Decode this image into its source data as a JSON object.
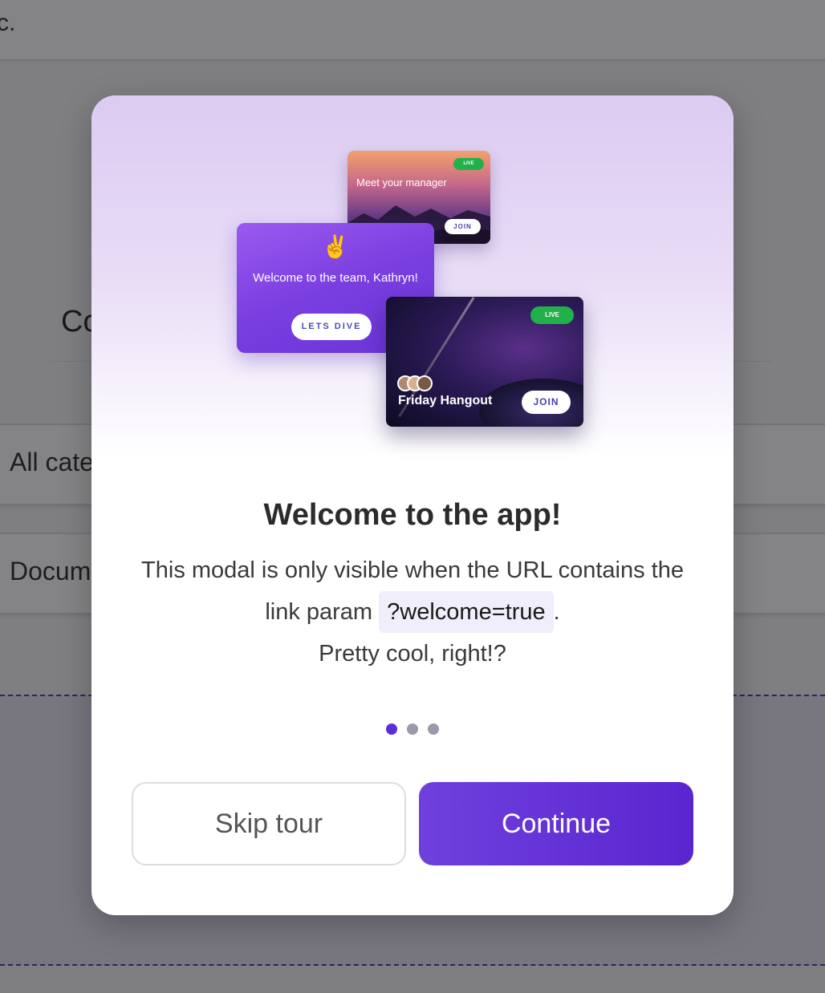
{
  "background": {
    "topbar_fragment": "c.",
    "heading_fragment": "Co",
    "select_1_fragment": "All cate",
    "select_2_fragment": "Docum"
  },
  "hero": {
    "manager_card": {
      "badge": "LIVE",
      "title": "Meet your manager",
      "join_label": "JOIN"
    },
    "welcome_card": {
      "emoji": "✌️",
      "text": "Welcome to the team, Kathryn!",
      "button_label": "LETS DIVE"
    },
    "hangout_card": {
      "badge": "LIVE",
      "title": "Friday Hangout",
      "join_label": "JOIN"
    }
  },
  "modal": {
    "title": "Welcome to the app!",
    "desc_part1": "This modal is only visible when the URL contains the link param",
    "desc_code": "?welcome=true",
    "desc_part2": ".",
    "desc_line3": "Pretty cool, right!?"
  },
  "pager": {
    "total": 3,
    "active_index": 0,
    "active_color": "#5a2fd6",
    "inactive_color": "#9a9aa8"
  },
  "buttons": {
    "skip_label": "Skip tour",
    "continue_label": "Continue"
  },
  "colors": {
    "accent": "#5a25d0",
    "live_badge": "#22b04b"
  }
}
